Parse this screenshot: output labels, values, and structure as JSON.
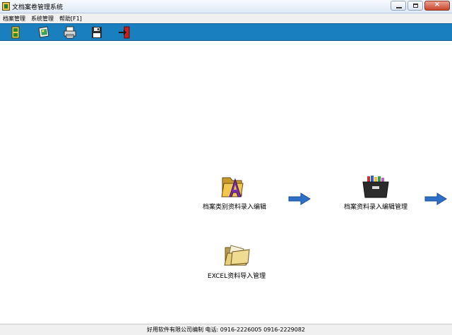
{
  "window": {
    "title": "文档案卷管理系统",
    "close_symbol": "×"
  },
  "menu": {
    "items": [
      {
        "label": "档案管理"
      },
      {
        "label": "系统管理"
      },
      {
        "label": "帮助[F1]"
      }
    ]
  },
  "toolbar": {
    "background": "#1a7fbe",
    "buttons": [
      {
        "icon": "green-binder-icon"
      },
      {
        "icon": "book-image-icon"
      },
      {
        "icon": "printer-icon"
      },
      {
        "icon": "floppy-disk-icon"
      },
      {
        "icon": "exit-door-icon"
      }
    ]
  },
  "workflow": {
    "nodes": [
      {
        "label": "档案类别资料录入编辑",
        "icon": "folder-letter-a-icon"
      },
      {
        "label": "档案资料录入编辑管理",
        "icon": "archive-box-icon"
      },
      {
        "label": "EXCEL资料导入管理",
        "icon": "open-folder-icon"
      }
    ],
    "arrow_color": "#2f6fc6"
  },
  "status": {
    "text": "好用软件有限公司编制  电话: 0916-2226005 0916-2229082"
  }
}
